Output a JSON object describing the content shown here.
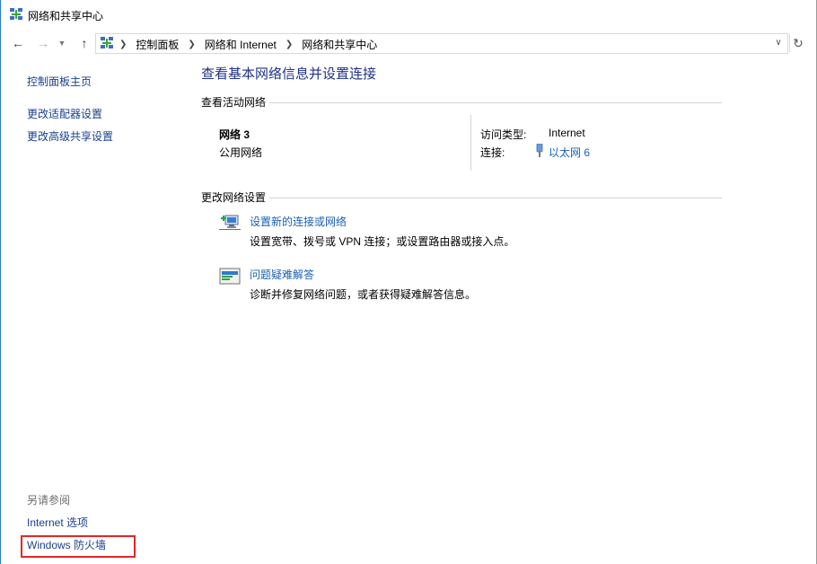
{
  "window": {
    "title": "网络和共享中心"
  },
  "address": {
    "crumbs": [
      "控制面板",
      "网络和 Internet",
      "网络和共享中心"
    ]
  },
  "left_pane": {
    "links": [
      "控制面板主页",
      "更改适配器设置",
      "更改高级共享设置"
    ],
    "see_also_label": "另请参阅",
    "see_also_links": [
      "Internet 选项",
      "Windows 防火墙"
    ]
  },
  "main": {
    "title": "查看基本网络信息并设置连接",
    "active_section_label": "查看活动网络",
    "network": {
      "name": "网络  3",
      "category": "公用网络",
      "access_label": "访问类型:",
      "access_value": "Internet",
      "connection_label": "连接:",
      "connection_value": "以太网 6"
    },
    "change_section_label": "更改网络设置",
    "tasks": [
      {
        "link": "设置新的连接或网络",
        "desc": "设置宽带、拨号或 VPN 连接；或设置路由器或接入点。",
        "icon": "new-connection-icon"
      },
      {
        "link": "问题疑难解答",
        "desc": "诊断并修复网络问题，或者获得疑难解答信息。",
        "icon": "troubleshoot-icon"
      }
    ]
  },
  "colors": {
    "title_blue": "#1e3287",
    "link_blue": "#1a5fb4",
    "highlight_red": "#e32626"
  }
}
